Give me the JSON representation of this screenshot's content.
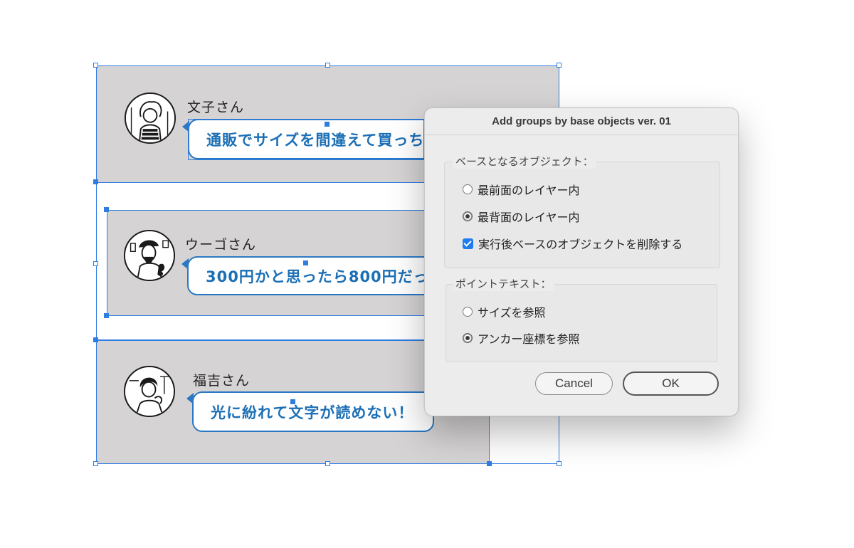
{
  "artboard": {
    "cards": [
      {
        "name": "文子さん",
        "message": "通販でサイズを間違えて買っち"
      },
      {
        "name": "ウーゴさん",
        "message": "300円かと思ったら800円だっ"
      },
      {
        "name": "福吉さん",
        "message": "光に紛れて文字が読めない！"
      }
    ]
  },
  "dialog": {
    "title": "Add groups by base objects ver. 01",
    "base_group": {
      "legend": "ベースとなるオブジェクト：",
      "options": [
        {
          "label": "最前面のレイヤー内",
          "selected": false
        },
        {
          "label": "最背面のレイヤー内",
          "selected": true
        }
      ],
      "checkbox": {
        "label": "実行後ベースのオブジェクトを削除する",
        "checked": true
      }
    },
    "text_group": {
      "legend": "ポイントテキスト：",
      "options": [
        {
          "label": "サイズを参照",
          "selected": false
        },
        {
          "label": "アンカー座標を参照",
          "selected": true
        }
      ]
    },
    "buttons": {
      "cancel": "Cancel",
      "ok": "OK"
    }
  },
  "colors": {
    "accent": "#2f7de1",
    "bubble_text": "#1b6fb5",
    "card_bg": "#d5d3d3",
    "checkbox": "#1f7cf0"
  }
}
